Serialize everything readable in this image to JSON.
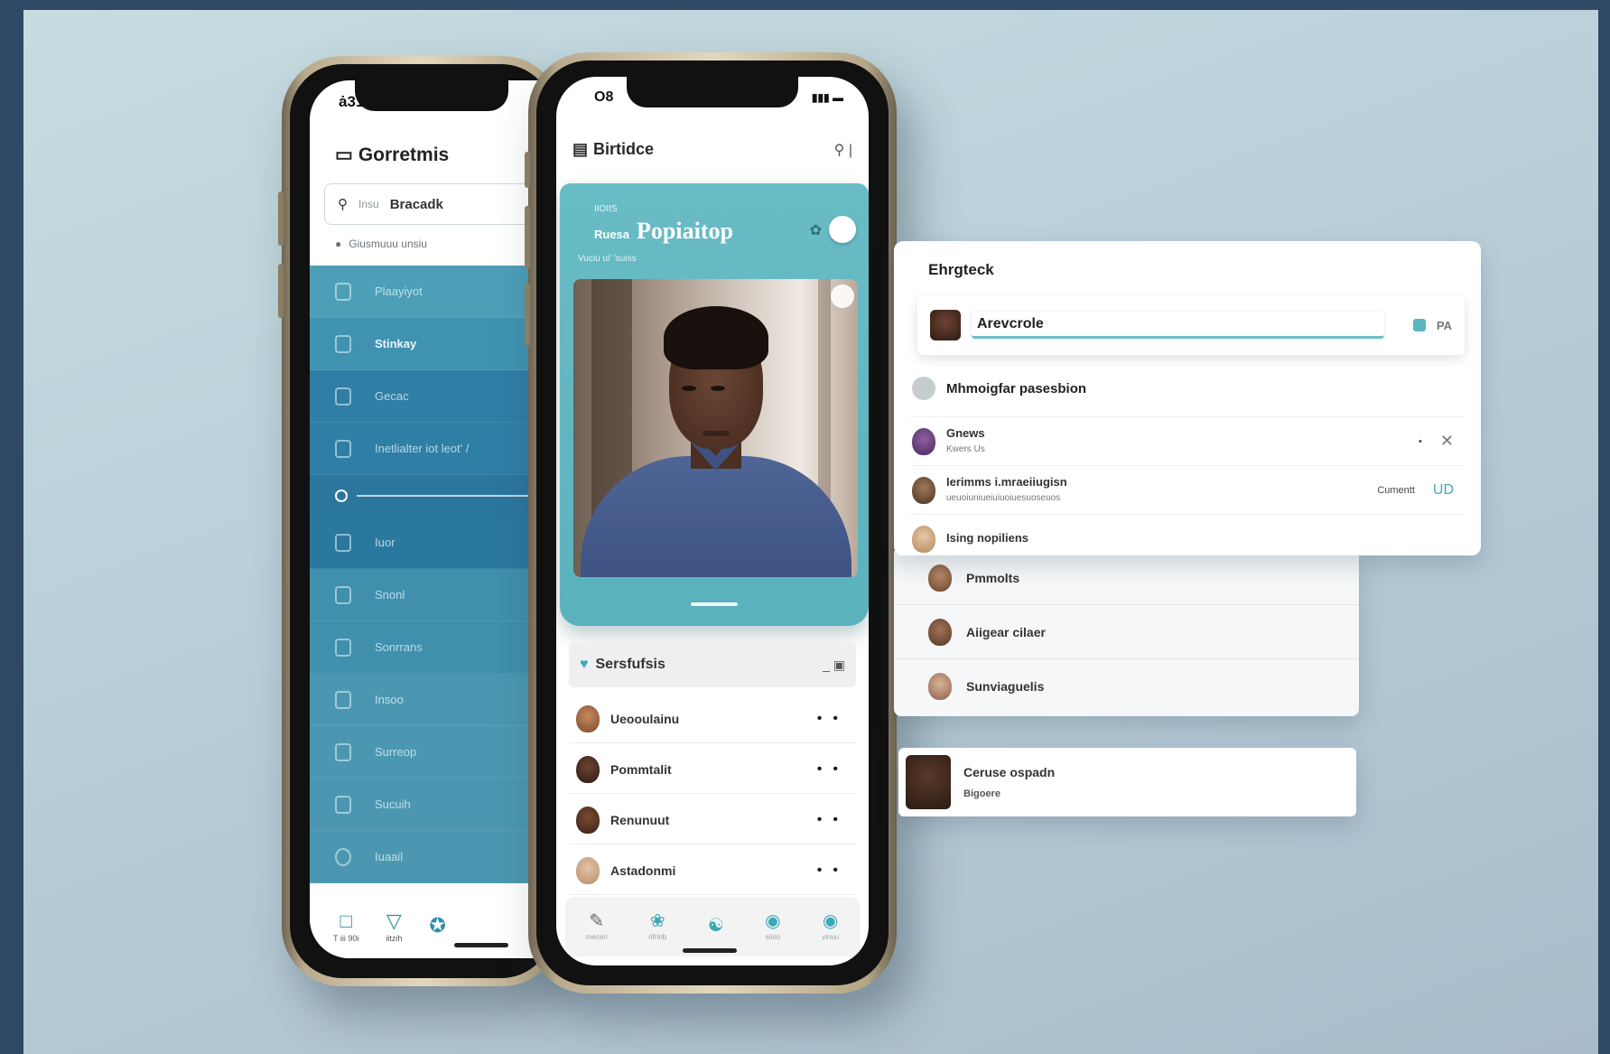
{
  "phone1": {
    "status_time": "ȧ31",
    "title": "Gorretmis",
    "search": {
      "placeholder": "Insu",
      "value": "Bracadk"
    },
    "subtitle": "Giusmuuu unsiu",
    "menu": [
      {
        "label": "Plaayiyot",
        "icon": "phone-icon"
      },
      {
        "label": "Stinkay",
        "icon": "grid-icon"
      },
      {
        "label": "Gecac",
        "icon": "pin-icon"
      },
      {
        "label": "Inetlialter  iot leot' /",
        "icon": "bell-icon"
      },
      {
        "label": "Iuor",
        "icon": "search-icon"
      },
      {
        "label": "Snonl",
        "icon": "hand-icon"
      },
      {
        "label": "Sonrrans",
        "icon": "bookmark-icon"
      },
      {
        "label": "Insoo",
        "icon": "chat-icon"
      },
      {
        "label": "Surreop",
        "icon": "play-icon"
      },
      {
        "label": "Sucuih",
        "icon": "door-icon"
      },
      {
        "label": "Iuaail",
        "icon": "circle-icon"
      }
    ],
    "tabs": [
      {
        "label": "T iii 90i",
        "icon": "square-icon"
      },
      {
        "label": "iitzih",
        "icon": "heart-icon"
      },
      {
        "label": "",
        "icon": "run-icon"
      }
    ]
  },
  "phone2": {
    "status_time": "O8",
    "title": "Birtidce",
    "card": {
      "small_lines": [
        "IIOIIS",
        "Ruesa"
      ],
      "headline": "Popiaitop",
      "subline": "Vuciu ui' 'suiss"
    },
    "section_title": "Sersfufsis",
    "list": [
      {
        "name": "Ueooulainu"
      },
      {
        "name": "Pommtalit"
      },
      {
        "name": "Renunuut"
      },
      {
        "name": "Astadonmi"
      }
    ],
    "tabs": [
      {
        "label": "meceri",
        "icon": "edit-icon"
      },
      {
        "label": "rifrinb",
        "icon": "leaf-icon"
      },
      {
        "label": "",
        "icon": "people-icon"
      },
      {
        "label": "siirio",
        "icon": "chat-icon"
      },
      {
        "label": "vinuu",
        "icon": "profile-icon"
      }
    ]
  },
  "panelA": {
    "title": "Ehrgteck",
    "field_value": "Arevcrole",
    "code": "PA",
    "subtitle": "Mhmoigfar pasesbion",
    "rows": [
      {
        "title": "Gnews",
        "sub": "Kwers Us",
        "action": "",
        "action_icon": "close-icon"
      },
      {
        "title": "Ierimms i.mraeiiugisn",
        "sub": "ueuoiuniueiuiuoiuesuoseuos",
        "action": "Cumentt",
        "action_icon": "ud-icon"
      },
      {
        "title": "Ising nopiliens",
        "sub": "",
        "action": "",
        "action_icon": ""
      }
    ]
  },
  "panelB": {
    "rows": [
      {
        "name": "Pmmolts"
      },
      {
        "name": "Aiigear cilaer"
      },
      {
        "name": "Sunviaguelis"
      }
    ]
  },
  "panelC": {
    "title": "Ceruse ospadn",
    "sub": "Bigoere"
  }
}
